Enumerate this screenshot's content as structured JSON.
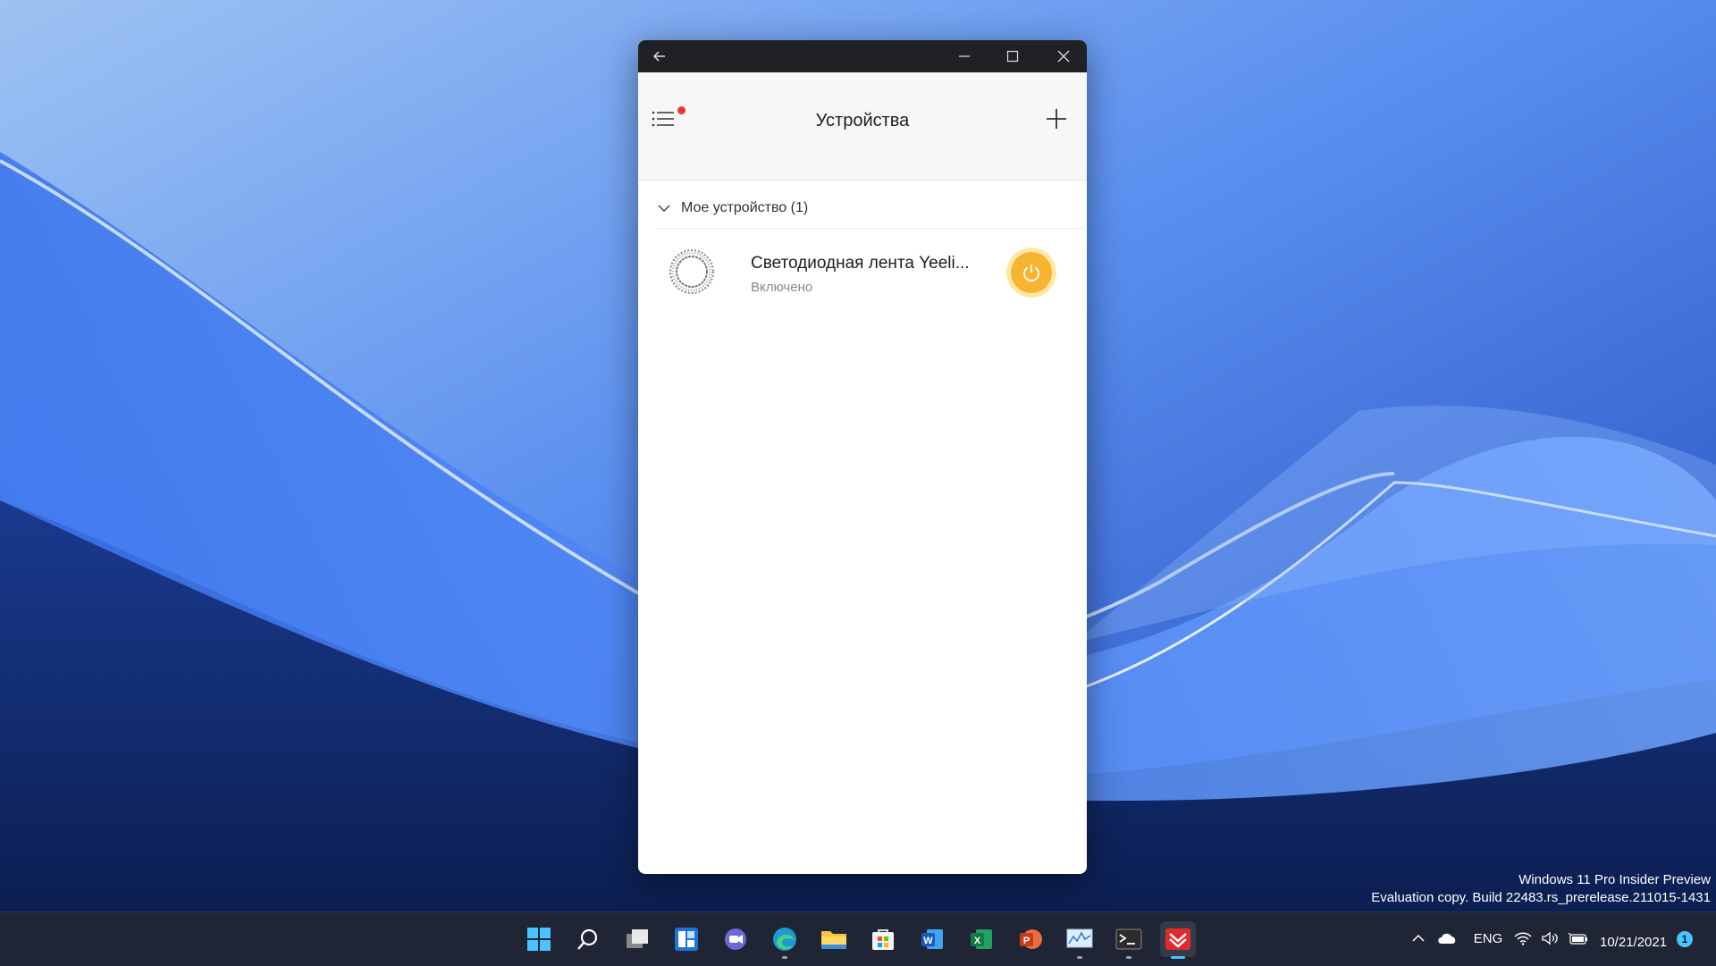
{
  "window": {
    "back_icon": "arrow-left-icon",
    "minimize_icon": "minimize-icon",
    "maximize_icon": "maximize-icon",
    "close_icon": "close-icon"
  },
  "app": {
    "title": "Устройства",
    "menu_icon": "menu-icon",
    "add_icon": "plus-icon",
    "group": {
      "label": "Мое устройство (1)",
      "expanded": true
    },
    "devices": [
      {
        "name": "Светодиодная лента Yeeli...",
        "status": "Включено",
        "power_on": true
      }
    ],
    "accent_color": "#f6b531"
  },
  "watermark": {
    "line1": "Windows 11 Pro Insider Preview",
    "line2": "Evaluation copy. Build 22483.rs_prerelease.211015-1431"
  },
  "taskbar": {
    "apps": [
      {
        "name": "start",
        "icon": "windows-logo-icon"
      },
      {
        "name": "search",
        "icon": "search-icon"
      },
      {
        "name": "task-view",
        "icon": "task-view-icon"
      },
      {
        "name": "widgets",
        "icon": "widgets-icon"
      },
      {
        "name": "chat",
        "icon": "chat-icon"
      },
      {
        "name": "edge",
        "icon": "edge-icon",
        "running": true
      },
      {
        "name": "file-explorer",
        "icon": "folder-icon"
      },
      {
        "name": "store",
        "icon": "store-icon"
      },
      {
        "name": "word",
        "icon": "word-icon"
      },
      {
        "name": "excel",
        "icon": "excel-icon"
      },
      {
        "name": "powerpoint",
        "icon": "powerpoint-icon"
      },
      {
        "name": "performance-monitor",
        "icon": "chart-icon",
        "running": true
      },
      {
        "name": "terminal",
        "icon": "terminal-icon",
        "running": true
      },
      {
        "name": "yeelight",
        "icon": "yeelight-icon",
        "active": true
      }
    ],
    "tray": {
      "language": "ENG",
      "date": "10/21/2021",
      "notifications": "1"
    }
  }
}
